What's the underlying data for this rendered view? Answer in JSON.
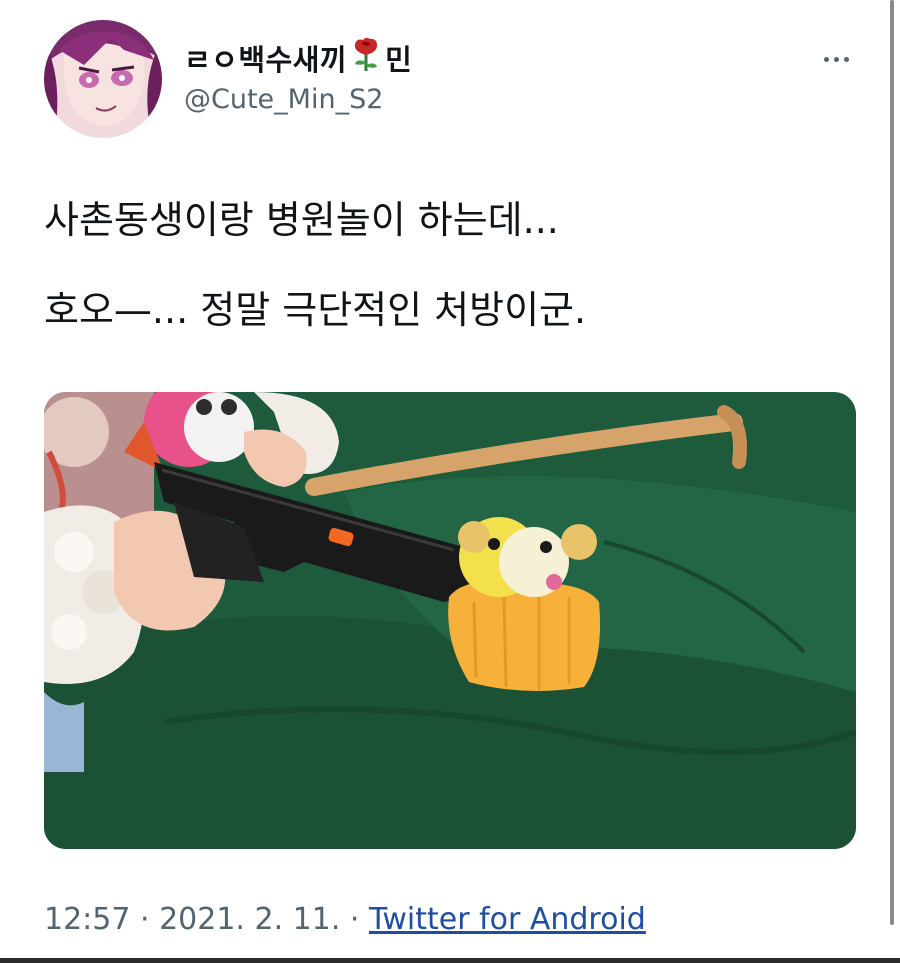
{
  "tweet": {
    "display_name_prefix": "ㄹㅇ백수새끼",
    "display_name_emoji": "rose-icon",
    "display_name_suffix": "민",
    "handle": "@Cute_Min_S2",
    "text_line_1": "사촌동생이랑 병원놀이 하는데...",
    "text_line_2": "호오—... 정말 극단적인 처방이군.",
    "time": "12:57",
    "separator": " · ",
    "date": "2021. 2. 11.",
    "source": "Twitter for Android"
  },
  "icons": {
    "more": "more-options-icon",
    "avatar": "anime-avatar-image"
  },
  "colors": {
    "text": "#0f1419",
    "secondary": "#536471",
    "link": "#1d4ea3",
    "photo_background": "#1f5a3a"
  }
}
